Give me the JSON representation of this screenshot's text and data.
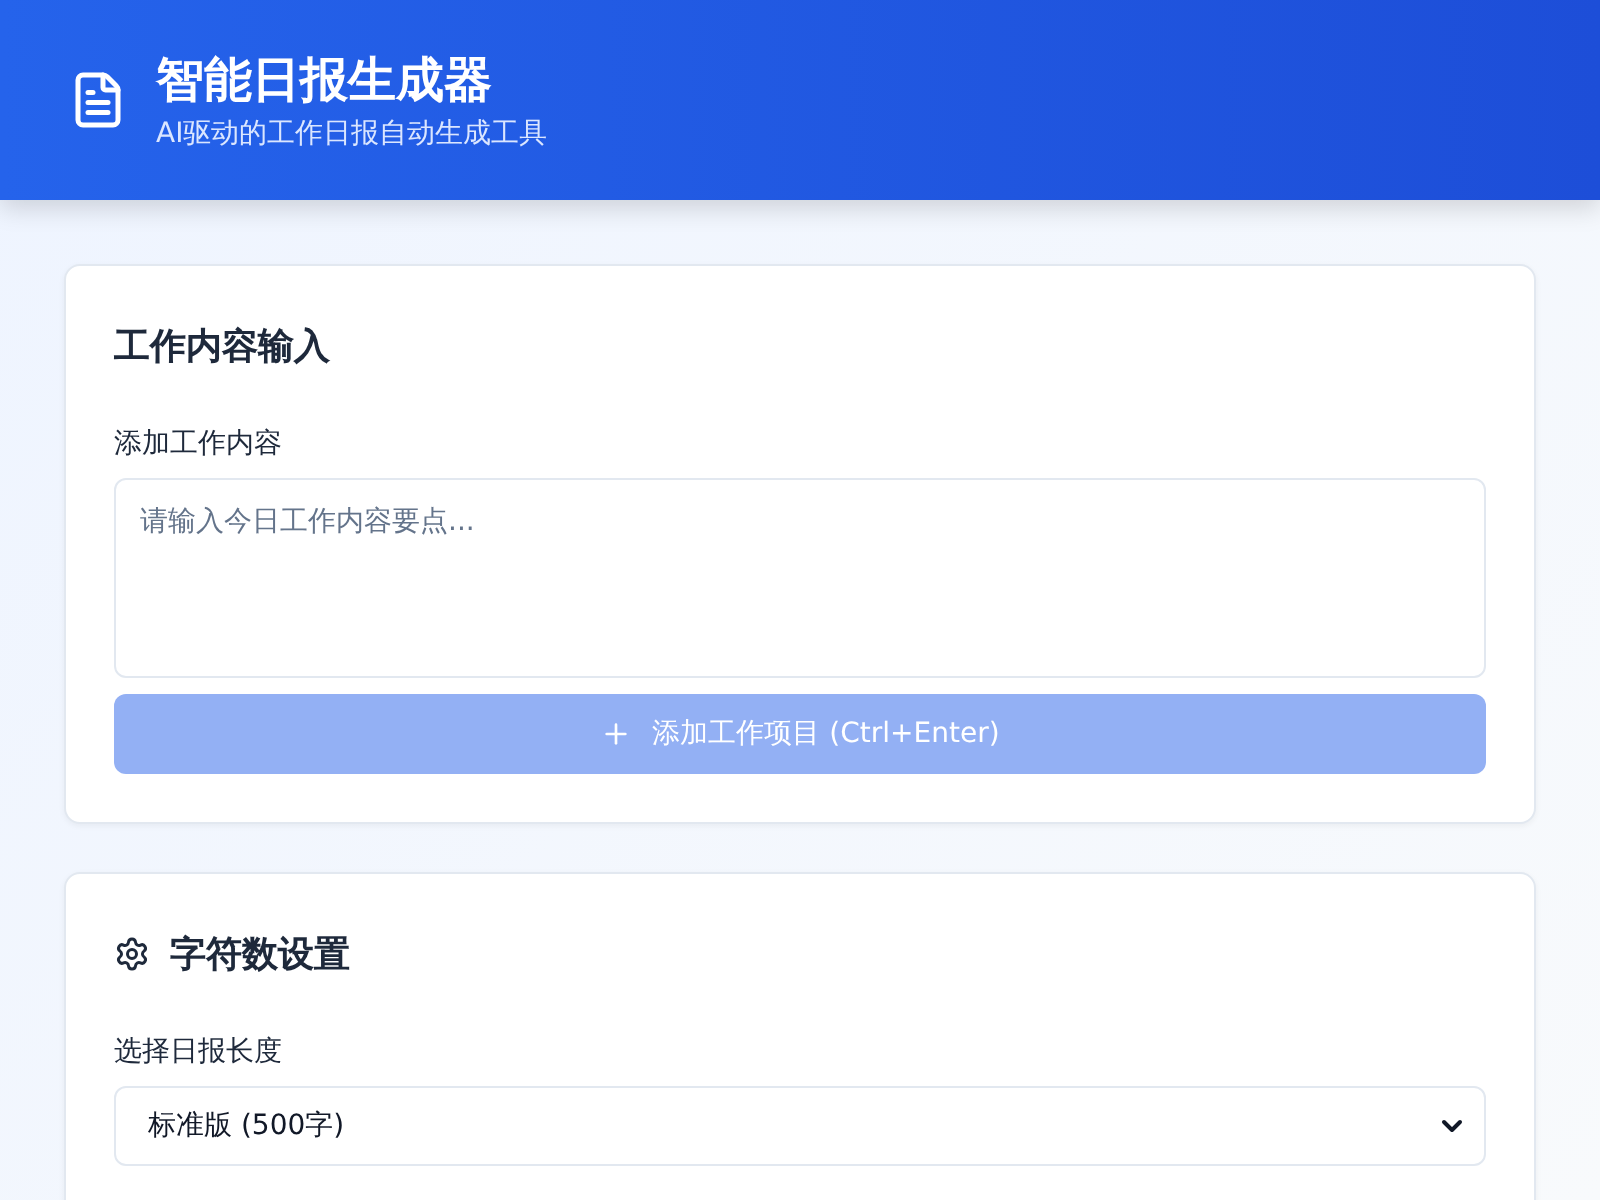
{
  "header": {
    "title": "智能日报生成器",
    "subtitle": "AI驱动的工作日报自动生成工具"
  },
  "input_card": {
    "title": "工作内容输入",
    "field_label": "添加工作内容",
    "textarea": {
      "placeholder": "请输入今日工作内容要点..."
    },
    "add_button": {
      "label": "添加工作项目 (Ctrl+Enter)",
      "disabled": true
    }
  },
  "settings_card": {
    "title": "字符数设置",
    "field_label": "选择日报长度",
    "length_select": {
      "value": "标准版 (500字)"
    }
  }
}
